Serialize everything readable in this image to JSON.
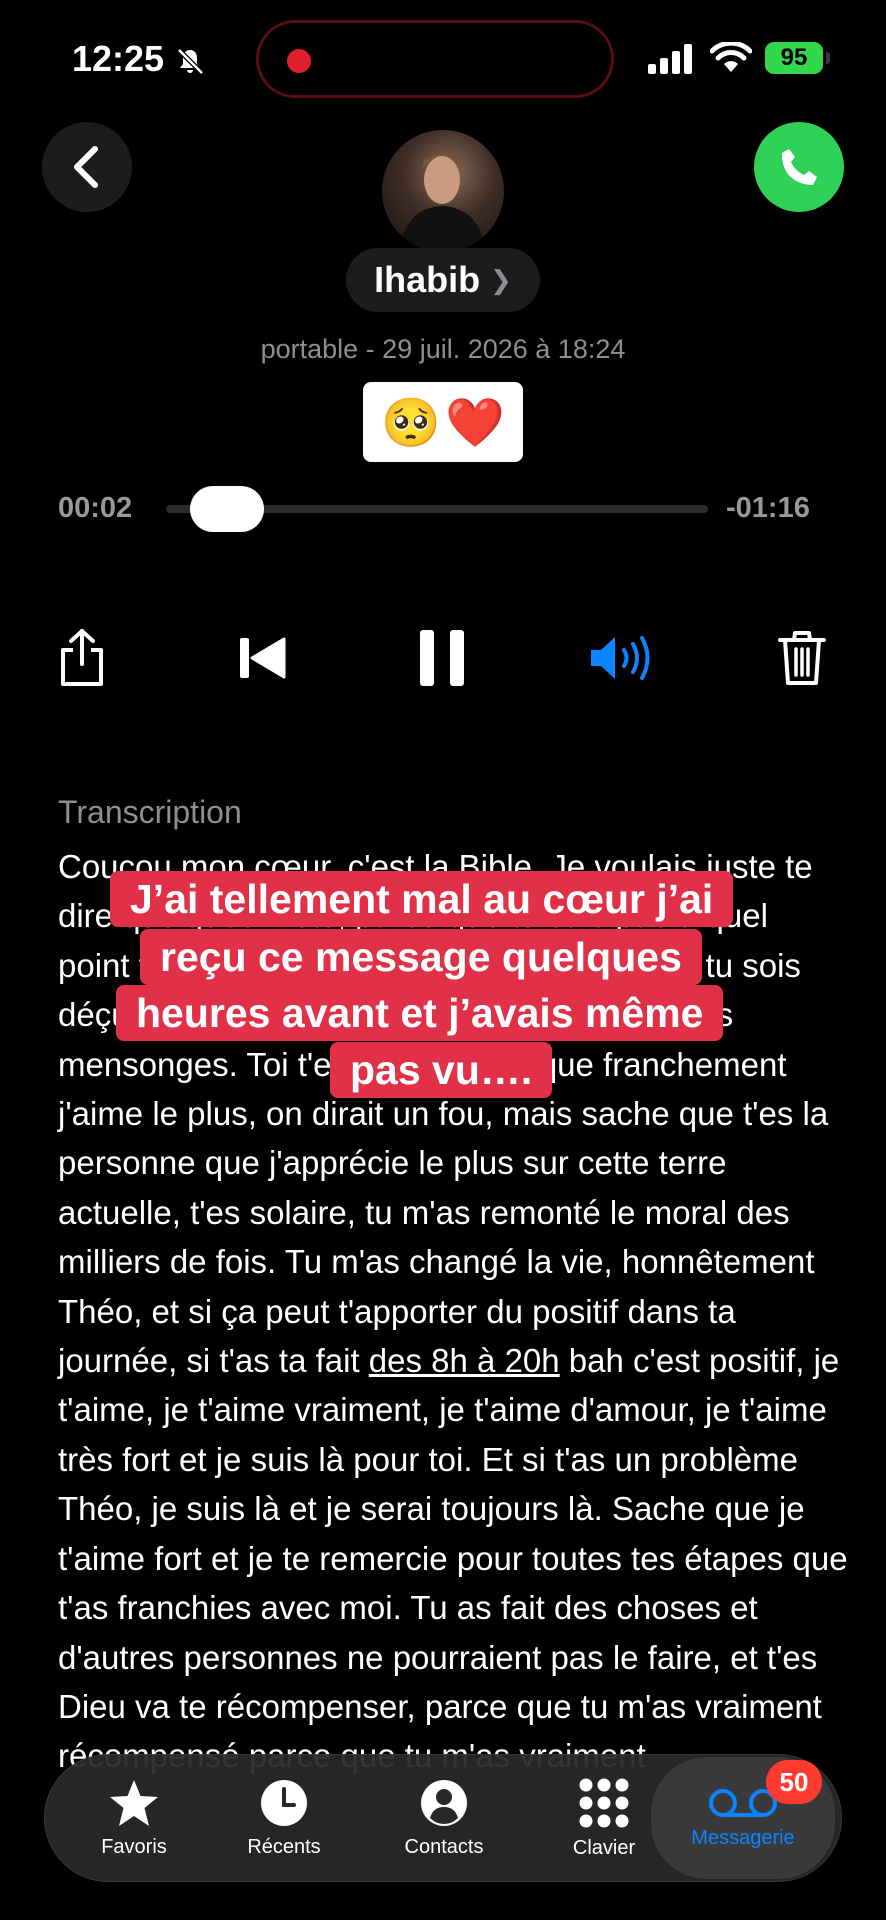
{
  "status_bar": {
    "time": "12:25",
    "battery": "95"
  },
  "contact": {
    "name": "Ihabib",
    "subtitle": "portable - 29 juil. 2026 à 18:24",
    "emoji": [
      "🥺",
      "❤️"
    ]
  },
  "player": {
    "elapsed": "00:02",
    "remaining": "-01:16",
    "progress_fraction": 0.025
  },
  "transcription": {
    "label": "Transcription",
    "text_before": "Coucou mon cœur, c'est la Bible. Je voulais juste te dire quelques mots, parce que tu sais pas à quel point tu comptes pour moi. Je veux pas que tu sois déçu, ou que tu penses que je te fais des gros mensonges. Toi t'es la personne que  franchement j'aime le plus, on dirait un fou, mais sache que t'es la personne que j'apprécie le plus sur cette terre actuelle, t'es solaire, tu m'as remonté le moral des milliers de fois. Tu m'as changé la vie, honnêtement Théo, et si ça peut t'apporter du positif dans ta journée, si t'as ta fait ",
    "underlined": "des 8h à 20h",
    "text_after": " bah  c'est positif, je t'aime, je t'aime vraiment, je t'aime d'amour, je t'aime très fort et je suis là pour toi. Et si t'as un problème Théo, je suis là et je serai toujours là. Sache que je t'aime fort et je te remercie pour toutes tes étapes que t'as franchies avec moi. Tu as fait des choses et d'autres personnes ne pourraient pas le faire, et t'es Dieu va te récompenser, parce que tu m'as vraiment récompensé parce que tu m'as vraiment"
  },
  "caption": {
    "lines": [
      "J’ai tellement mal au cœur j’ai",
      "reçu ce message quelques",
      "heures avant et j’avais même",
      "pas vu…."
    ]
  },
  "tabbar": {
    "tabs": [
      {
        "label": "Favoris",
        "icon": "star-icon"
      },
      {
        "label": "Récents",
        "icon": "clock-icon"
      },
      {
        "label": "Contacts",
        "icon": "person-icon"
      },
      {
        "label": "Clavier",
        "icon": "keypad-icon"
      },
      {
        "label": "Messagerie",
        "icon": "voicemail-icon"
      }
    ],
    "badge": "50"
  },
  "colors": {
    "accent": "#0a84ff",
    "call_green": "#30d158",
    "caption_red": "#e03149",
    "badge_red": "#ff3b30"
  }
}
